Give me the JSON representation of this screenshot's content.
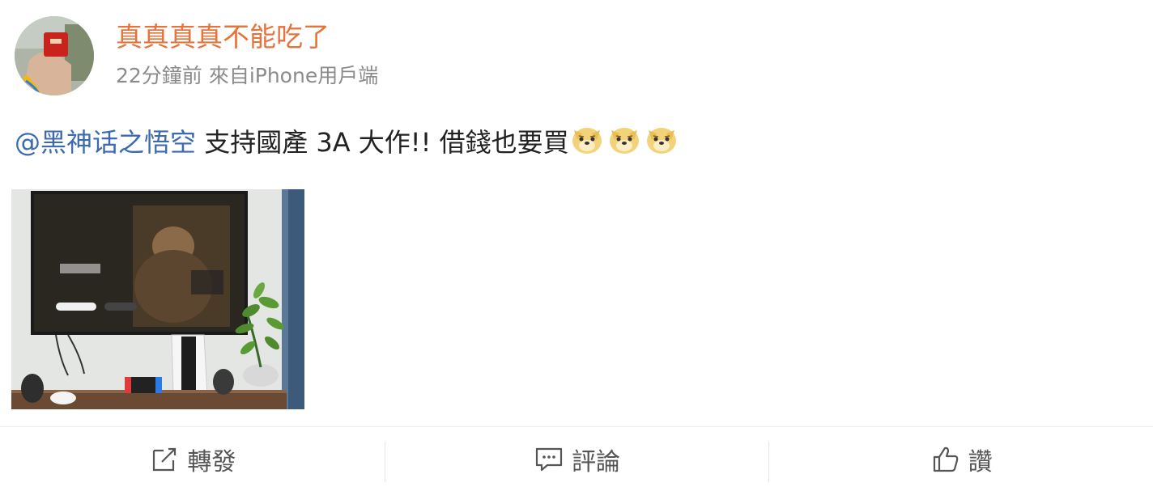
{
  "post": {
    "author": "真真真真不能吃了",
    "time": "22分鐘前",
    "source": "來自iPhone用戶端",
    "mention": "@黑神话之悟空",
    "text": " 支持國產 3A 大作!! 借錢也要買",
    "emojis": [
      "doge-emoji",
      "doge-emoji",
      "doge-emoji"
    ]
  },
  "actions": {
    "repost": {
      "label": "轉發",
      "icon": "share-icon"
    },
    "comment": {
      "label": "評論",
      "icon": "comment-icon"
    },
    "like": {
      "label": "讚",
      "icon": "thumbs-up-icon"
    }
  },
  "colors": {
    "author": "#e8733a",
    "mention": "#3b6ab0",
    "meta": "#8b8b8b",
    "action_text": "#555555"
  }
}
